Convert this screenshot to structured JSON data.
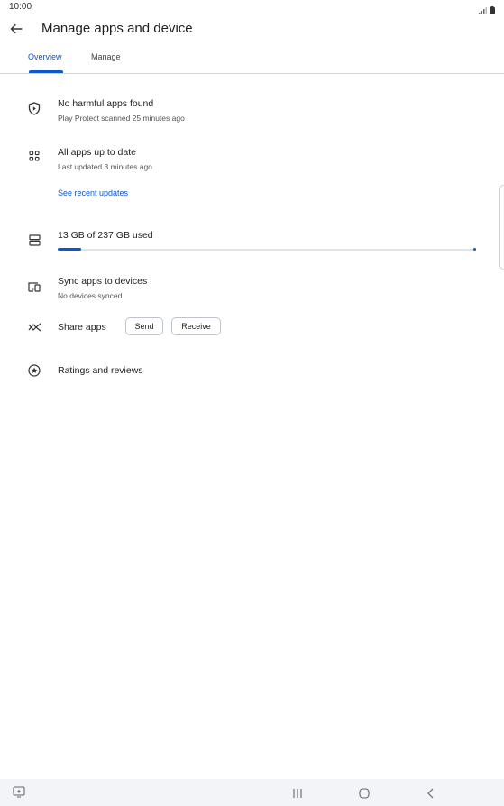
{
  "status_bar": {
    "time": "10:00",
    "icons": [
      "signal-icon",
      "battery-icon"
    ]
  },
  "header": {
    "title": "Manage apps and device",
    "back_icon": "arrow-left-icon"
  },
  "tabs": [
    {
      "label": "Overview",
      "active": true
    },
    {
      "label": "Manage",
      "active": false
    }
  ],
  "rows": {
    "protect": {
      "icon": "shield-play-icon",
      "title": "No harmful apps found",
      "subtitle": "Play Protect scanned 25 minutes ago"
    },
    "updates": {
      "icon": "apps-grid-icon",
      "title": "All apps up to date",
      "subtitle": "Last updated 3 minutes ago",
      "link": "See recent updates"
    },
    "storage": {
      "icon": "storage-icon",
      "title": "13 GB of 237 GB used",
      "used_fraction": 0.055
    },
    "sync": {
      "icon": "devices-icon",
      "title": "Sync apps to devices",
      "subtitle": "No devices synced"
    },
    "share": {
      "icon": "share-arrows-icon",
      "title": "Share apps",
      "send_label": "Send",
      "receive_label": "Receive"
    },
    "ratings": {
      "icon": "star-circle-icon",
      "title": "Ratings and reviews"
    }
  },
  "colors": {
    "accent": "#0b57d0",
    "divider": "#d5d5d5",
    "nav_bg": "#f2f4f7"
  },
  "nav_bar": {
    "icons": [
      "screen-assistant-icon",
      "recents-icon",
      "home-icon",
      "back-icon"
    ]
  }
}
